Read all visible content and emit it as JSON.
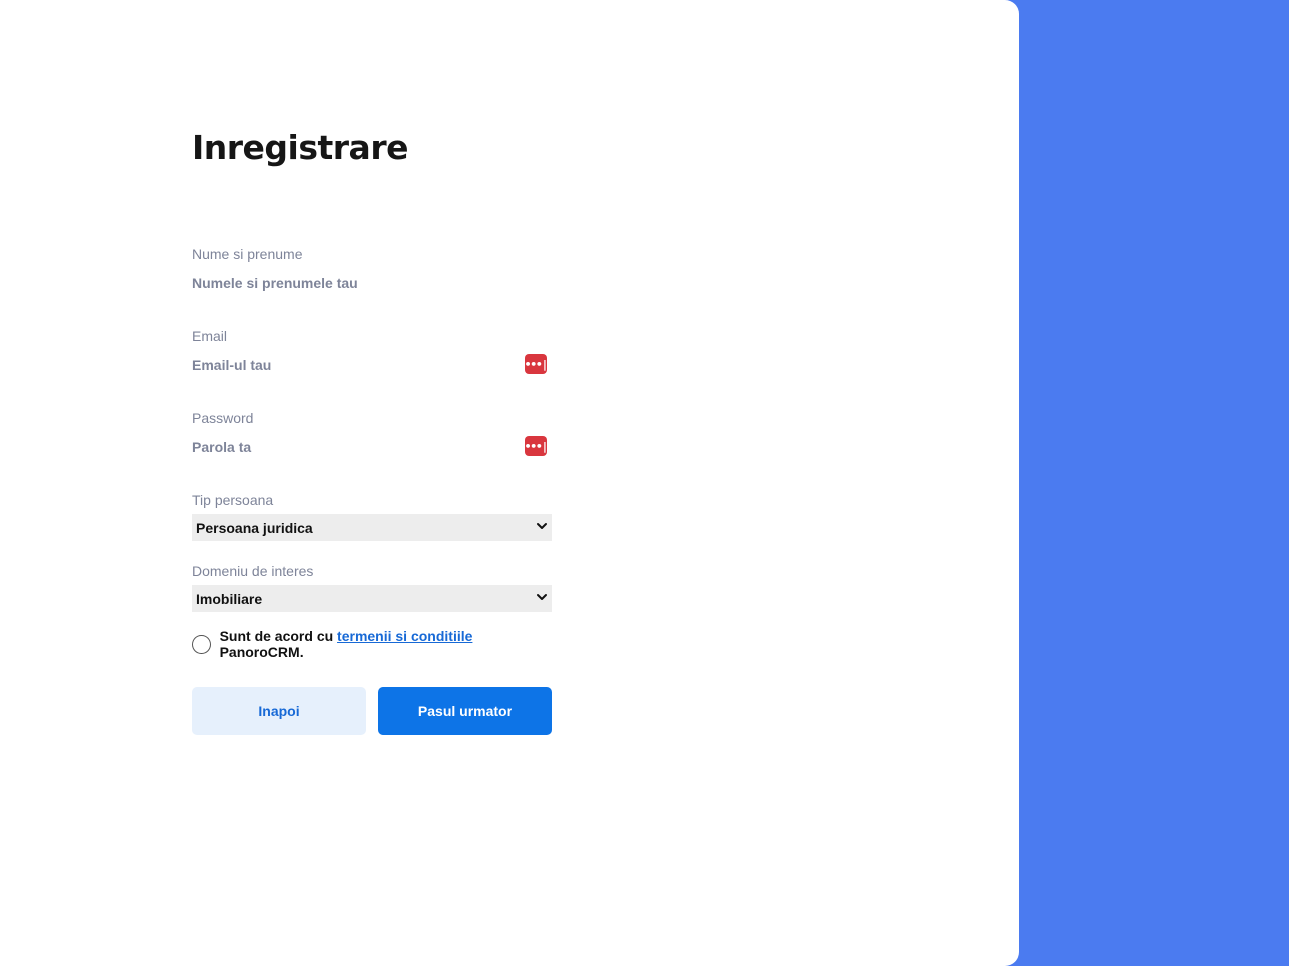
{
  "page": {
    "title": "Inregistrare"
  },
  "form": {
    "name": {
      "label": "Nume si prenume",
      "placeholder": "Numele si prenumele tau"
    },
    "email": {
      "label": "Email",
      "placeholder": "Email-ul tau",
      "icon": "password-manager-icon"
    },
    "password": {
      "label": "Password",
      "placeholder": "Parola ta",
      "icon": "password-manager-icon"
    },
    "person_type": {
      "label": "Tip persoana",
      "selected": "Persoana juridica"
    },
    "domain": {
      "label": "Domeniu de interes",
      "selected": "Imobiliare"
    },
    "terms": {
      "prefix": "Sunt de acord cu",
      "link": "termenii si conditiile",
      "suffix": "PanoroCRM."
    }
  },
  "buttons": {
    "back": "Inapoi",
    "next": "Pasul urmator"
  },
  "colors": {
    "side_panel": "#4b7bf0",
    "primary": "#0d74e7",
    "secondary_bg": "#e6f0fc",
    "icon_red": "#d9363e"
  }
}
